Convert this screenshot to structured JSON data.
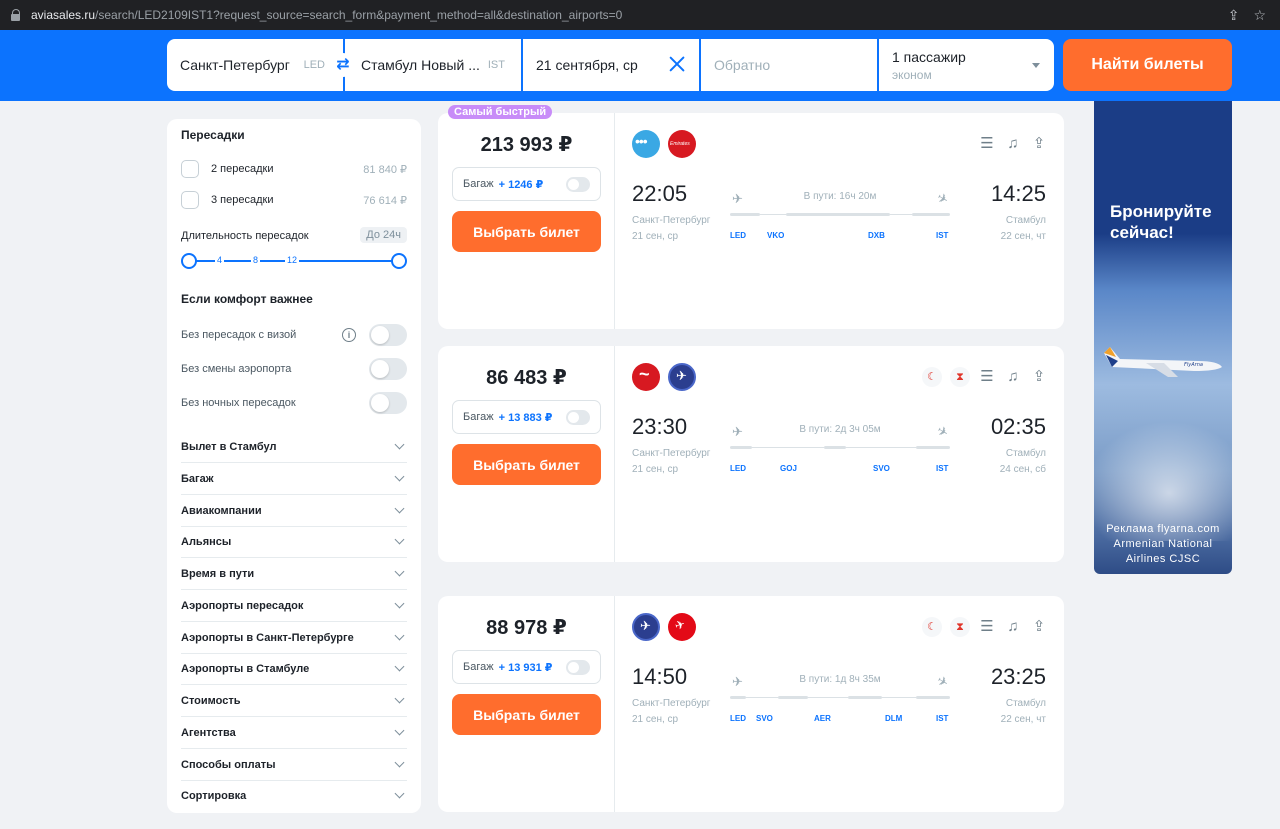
{
  "browser": {
    "host": "aviasales.ru",
    "path": "/search/LED2109IST1?request_source=search_form&payment_method=all&destination_airports=0"
  },
  "search": {
    "from_city": "Санкт-Петербург",
    "from_code": "LED",
    "to_city": "Стамбул Новый ...",
    "to_code": "IST",
    "date": "21 сентября, ср",
    "return_placeholder": "Обратно",
    "passengers": "1 пассажир",
    "class": "эконом",
    "find_label": "Найти билеты"
  },
  "filters": {
    "transfers_title": "Пересадки",
    "transfers": [
      {
        "label": "2 пересадки",
        "price": "81 840 ₽"
      },
      {
        "label": "3 пересадки",
        "price": "76 614 ₽"
      }
    ],
    "duration_label": "Длительность пересадок",
    "duration_value": "До 24ч",
    "slider_ticks": [
      "4",
      "8",
      "12"
    ],
    "comfort_title": "Если комфорт важнее",
    "comfort_options": [
      {
        "label": "Без пересадок с визой"
      },
      {
        "label": "Без смены аэропорта"
      },
      {
        "label": "Без ночных пересадок"
      }
    ],
    "sections": [
      "Вылет в Стамбул",
      "Багаж",
      "Авиакомпании",
      "Альянсы",
      "Время в пути",
      "Аэропорты пересадок",
      "Аэропорты в Санкт-Петербурге",
      "Аэропорты в Стамбуле",
      "Стоимость",
      "Агентства",
      "Способы оплаты",
      "Сортировка"
    ]
  },
  "tickets": [
    {
      "badge": "Самый быстрый",
      "price": "213 993 ₽",
      "baggage_label": "Багаж",
      "baggage_price": "+ 1246 ₽",
      "choose_label": "Выбрать билет",
      "depart_time": "22:05",
      "depart_city": "Санкт-Петербург",
      "depart_date": "21 сен, ср",
      "duration": "В пути: 16ч 20м",
      "arrive_time": "14:25",
      "arrive_city": "Стамбул",
      "arrive_date": "22 сен, чт",
      "airports": [
        "LED",
        "VKO",
        "DXB",
        "IST"
      ],
      "airline_logo_text": "Emirates"
    },
    {
      "price": "86 483 ₽",
      "baggage_label": "Багаж",
      "baggage_price": "+ 13 883 ₽",
      "choose_label": "Выбрать билет",
      "depart_time": "23:30",
      "depart_city": "Санкт-Петербург",
      "depart_date": "21 сен, ср",
      "duration": "В пути: 2д 3ч 05м",
      "arrive_time": "02:35",
      "arrive_city": "Стамбул",
      "arrive_date": "24 сен, сб",
      "airports": [
        "LED",
        "GOJ",
        "SVO",
        "IST"
      ]
    },
    {
      "price": "88 978 ₽",
      "baggage_label": "Багаж",
      "baggage_price": "+ 13 931 ₽",
      "choose_label": "Выбрать билет",
      "depart_time": "14:50",
      "depart_city": "Санкт-Петербург",
      "depart_date": "21 сен, ср",
      "duration": "В пути: 1д 8ч 35м",
      "arrive_time": "23:25",
      "arrive_city": "Стамбул",
      "arrive_date": "22 сен, чт",
      "airports": [
        "LED",
        "SVO",
        "AER",
        "DLM",
        "IST"
      ]
    }
  ],
  "ad": {
    "headline_1": "Бронируйте",
    "headline_2": "сейчас!",
    "footer_1": "Реклама flyarna.com",
    "footer_2": "Armenian National",
    "footer_3": "Airlines CJSC",
    "plane_livery": "FlyArna"
  },
  "colors": {
    "header_blue": "#0c73fe",
    "accent_orange": "#ff6d2d",
    "badge_purple": "#c88cf8"
  }
}
